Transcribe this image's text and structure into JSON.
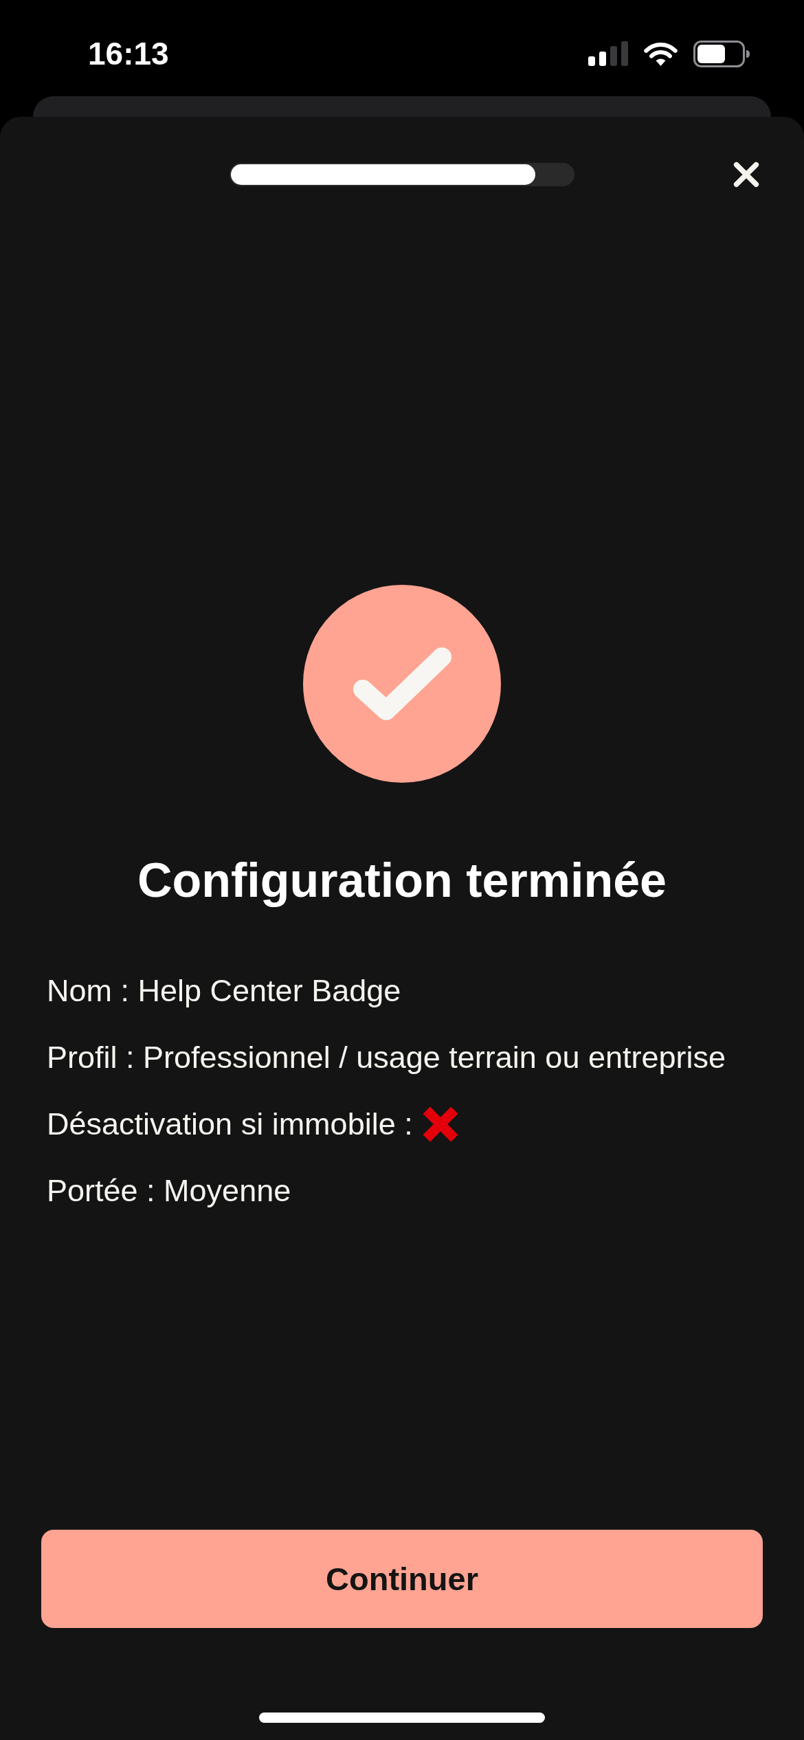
{
  "status_bar": {
    "time": "16:13"
  },
  "progress": {
    "level": 0.89
  },
  "result": {
    "title": "Configuration terminée"
  },
  "summary": [
    {
      "kind": "text",
      "text": "Nom : Help Center Badge"
    },
    {
      "kind": "text",
      "text": "Profil : Professionnel / usage terrain ou entreprise"
    },
    {
      "kind": "flag",
      "text": "Désactivation si immobile :",
      "on": false
    },
    {
      "kind": "text",
      "text": "Portée : Moyenne"
    }
  ],
  "primary_button": {
    "label": "Continuer"
  }
}
